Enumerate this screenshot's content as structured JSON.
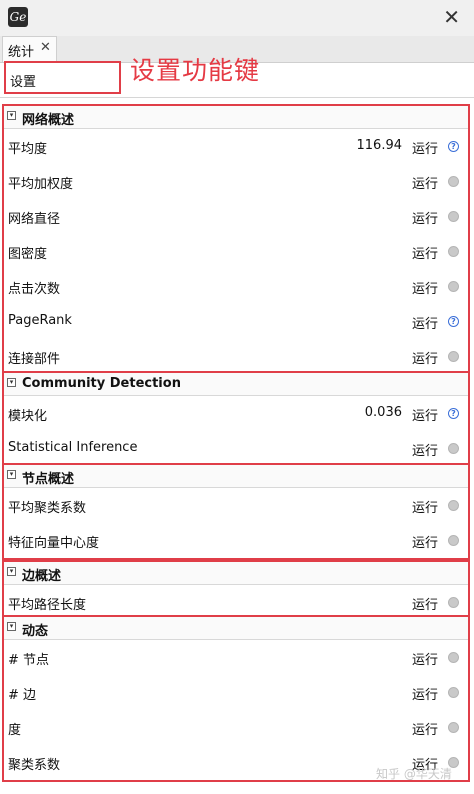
{
  "window": {
    "app_icon_text": "Ge",
    "close_glyph": "✕"
  },
  "tab": {
    "label": "统计",
    "close_glyph": "✕"
  },
  "settings": {
    "label": "设置"
  },
  "annotation": {
    "text": "设置功能键"
  },
  "sections": [
    {
      "title": "网络概述",
      "rows": [
        {
          "label": "平均度",
          "value": "116.94",
          "run": "运行",
          "info": "help"
        },
        {
          "label": "平均加权度",
          "value": "",
          "run": "运行",
          "info": "plain"
        },
        {
          "label": "网络直径",
          "value": "",
          "run": "运行",
          "info": "plain"
        },
        {
          "label": "图密度",
          "value": "",
          "run": "运行",
          "info": "plain"
        },
        {
          "label": "点击次数",
          "value": "",
          "run": "运行",
          "info": "plain"
        },
        {
          "label": "PageRank",
          "value": "",
          "run": "运行",
          "info": "help"
        },
        {
          "label": "连接部件",
          "value": "",
          "run": "运行",
          "info": "plain"
        }
      ]
    },
    {
      "title": "Community Detection",
      "rows": [
        {
          "label": "模块化",
          "value": "0.036",
          "run": "运行",
          "info": "help"
        },
        {
          "label": "Statistical Inference",
          "value": "",
          "run": "运行",
          "info": "plain"
        }
      ]
    },
    {
      "title": "节点概述",
      "rows": [
        {
          "label": "平均聚类系数",
          "value": "",
          "run": "运行",
          "info": "plain"
        },
        {
          "label": "特征向量中心度",
          "value": "",
          "run": "运行",
          "info": "plain"
        }
      ]
    },
    {
      "title": "边概述",
      "rows": [
        {
          "label": "平均路径长度",
          "value": "",
          "run": "运行",
          "info": "plain"
        }
      ]
    },
    {
      "title": "动态",
      "rows": [
        {
          "label": "# 节点",
          "value": "",
          "run": "运行",
          "info": "plain"
        },
        {
          "label": "# 边",
          "value": "",
          "run": "运行",
          "info": "plain"
        },
        {
          "label": "度",
          "value": "",
          "run": "运行",
          "info": "plain"
        },
        {
          "label": "聚类系数",
          "value": "",
          "run": "运行",
          "info": "plain"
        }
      ]
    }
  ],
  "toggle_glyph": "▾",
  "help_glyph": "?",
  "watermark": "知乎 @华天清",
  "colors": {
    "annotation_red": "#e53a44",
    "help_blue": "#3b6fd8"
  }
}
